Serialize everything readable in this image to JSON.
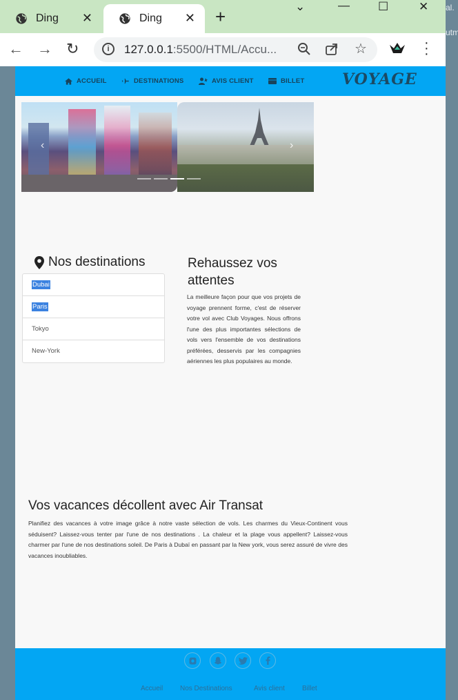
{
  "browser": {
    "tabs": [
      {
        "title": "Ding"
      },
      {
        "title": "Ding"
      }
    ],
    "url_host": "127.0.0.1",
    "url_rest": ":5500/HTML/Accu...",
    "edge_text_1": "al.",
    "edge_text_2": "utm"
  },
  "site": {
    "nav": {
      "accueil": "ACCUEIL",
      "destinations": "DESTINATIONS",
      "avis": "AVIS CLIENT",
      "billet": "BILLET",
      "logo": "VOYAGE"
    },
    "carousel": {
      "slides": [
        "Tokyo",
        "Paris"
      ],
      "active_indicator": 3,
      "indicator_count": 4
    },
    "destinations": {
      "title": "Nos destinations",
      "items": [
        "Dubai",
        "Paris",
        "Tokyo",
        "New-York"
      ],
      "selected": [
        "Dubai",
        "Paris"
      ]
    },
    "rehaussez": {
      "title": "Rehaussez vos attentes",
      "text": "La meilleure façon pour que vos projets de voyage prennent forme, c'est de réserver votre vol avec Club Voyages. Nous offrons l'une des plus importantes sélections de vols vers l'ensemble de vos destinations préférées, desservis par les compagnies aériennes les plus populaires au monde."
    },
    "vacances": {
      "title": "Vos vacances décollent avec Air Transat",
      "text": "Planifiez des vacances à votre image grâce à notre vaste sélection de vols. Les charmes du Vieux-Continent vous séduisent? Laissez-vous tenter par l'une de nos destinations . La chaleur et la plage vous appellent? Laissez-vous charmer par l'une de nos destinations soleil. De Paris à Dubaï en passant par la New york, vous serez assuré de vivre des vacances inoubliables."
    },
    "footer": {
      "social": [
        "instagram-icon",
        "snapchat-icon",
        "twitter-icon",
        "facebook-icon"
      ],
      "links": [
        "Accueil",
        "Nos Destinations",
        "Avis client",
        "Billet"
      ]
    }
  }
}
